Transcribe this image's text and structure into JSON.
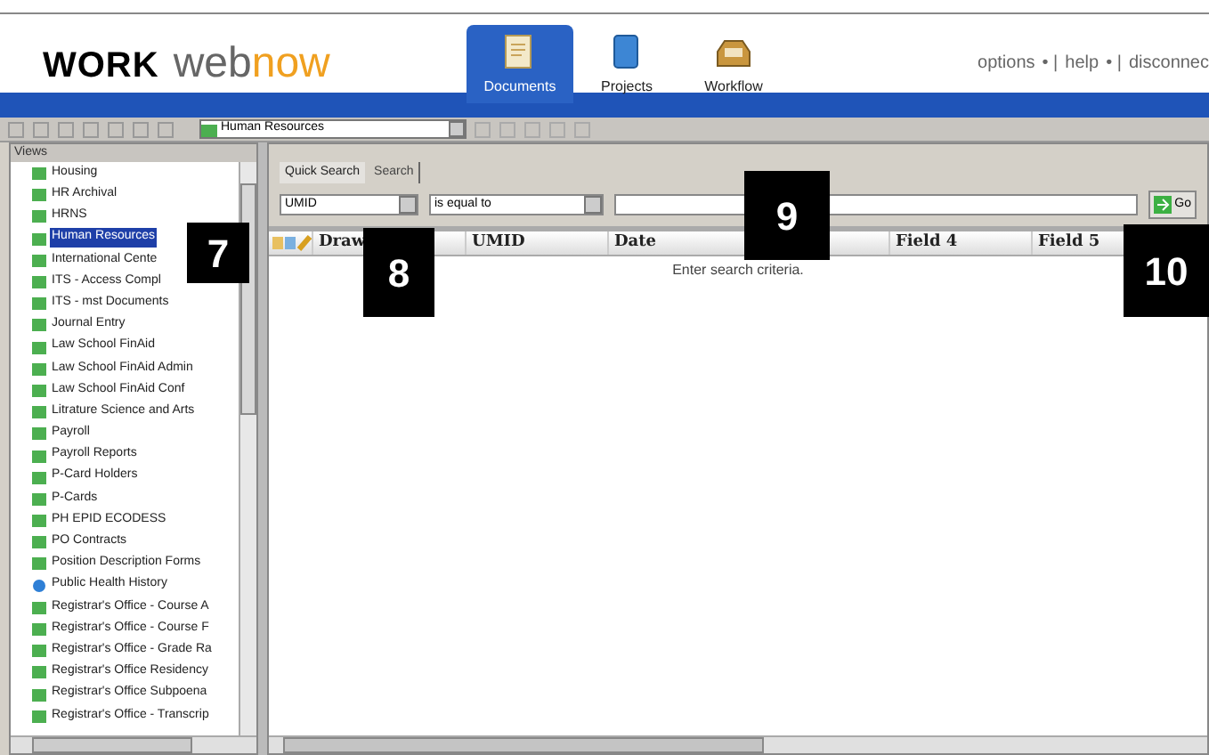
{
  "header": {
    "logo_work": "WORK",
    "logo_web": "web",
    "logo_now": "now",
    "nav": [
      {
        "label": "Documents",
        "selected": true,
        "kind": "documents"
      },
      {
        "label": "Projects",
        "selected": false,
        "kind": "projects"
      },
      {
        "label": "Workflow",
        "selected": false,
        "kind": "workflow"
      }
    ],
    "links": [
      "options",
      "help",
      "disconnec"
    ],
    "separator": "• |"
  },
  "toolbar": {
    "view_select": "Human Resources"
  },
  "sidebar": {
    "title": "Views",
    "items": [
      {
        "label": "Housing",
        "selected": false,
        "kind": "view"
      },
      {
        "label": "HR Archival",
        "selected": false,
        "kind": "view"
      },
      {
        "label": "HRNS",
        "selected": false,
        "kind": "view"
      },
      {
        "label": "Human Resources",
        "selected": true,
        "kind": "view"
      },
      {
        "label": "International Cente",
        "selected": false,
        "kind": "view"
      },
      {
        "label": "ITS - Access Compl",
        "selected": false,
        "kind": "view"
      },
      {
        "label": "ITS - mst Documents",
        "selected": false,
        "kind": "view"
      },
      {
        "label": "Journal Entry",
        "selected": false,
        "kind": "view"
      },
      {
        "label": "Law School FinAid",
        "selected": false,
        "kind": "view"
      },
      {
        "label": "Law School FinAid Admin",
        "selected": false,
        "kind": "view"
      },
      {
        "label": "Law School FinAid Conf",
        "selected": false,
        "kind": "view"
      },
      {
        "label": "Litrature Science and Arts",
        "selected": false,
        "kind": "view"
      },
      {
        "label": "Payroll",
        "selected": false,
        "kind": "view"
      },
      {
        "label": "Payroll Reports",
        "selected": false,
        "kind": "view"
      },
      {
        "label": "P-Card Holders",
        "selected": false,
        "kind": "view"
      },
      {
        "label": "P-Cards",
        "selected": false,
        "kind": "view"
      },
      {
        "label": "PH EPID ECODESS",
        "selected": false,
        "kind": "view"
      },
      {
        "label": "PO Contracts",
        "selected": false,
        "kind": "view"
      },
      {
        "label": "Position Description Forms",
        "selected": false,
        "kind": "view"
      },
      {
        "label": "Public Health History",
        "selected": false,
        "kind": "shared"
      },
      {
        "label": "Registrar's Office - Course A",
        "selected": false,
        "kind": "view"
      },
      {
        "label": "Registrar's Office - Course F",
        "selected": false,
        "kind": "view"
      },
      {
        "label": "Registrar's Office - Grade Ra",
        "selected": false,
        "kind": "view"
      },
      {
        "label": "Registrar's Office Residency",
        "selected": false,
        "kind": "view"
      },
      {
        "label": "Registrar's Office Subpoena",
        "selected": false,
        "kind": "view"
      },
      {
        "label": "Registrar's Office - Transcrip",
        "selected": false,
        "kind": "view"
      }
    ]
  },
  "search": {
    "tabs": [
      {
        "label": "Quick Search",
        "selected": true
      },
      {
        "label": "Search",
        "selected": false
      }
    ],
    "field": "UMID",
    "operator": "is equal to",
    "go": "Go"
  },
  "table": {
    "columns": [
      "Draw",
      "UMID",
      "Date",
      "Field 4",
      "Field 5"
    ],
    "message": "Enter search criteria."
  },
  "callouts": [
    "7",
    "8",
    "9",
    "10"
  ]
}
